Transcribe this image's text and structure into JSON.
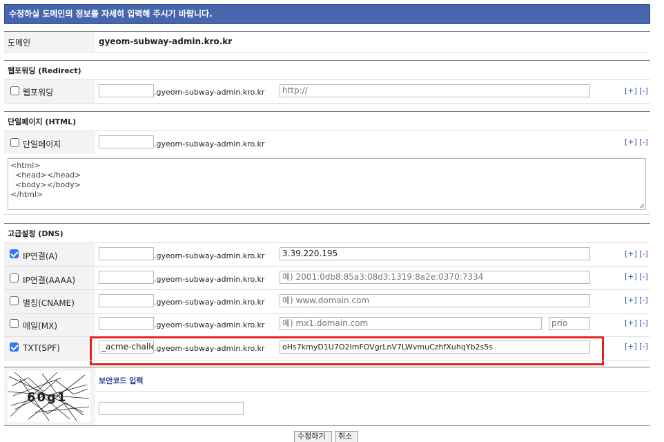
{
  "banner": "수정하실 도메인의 정보를 자세히 입력해 주시기 바랍니다.",
  "domain_row": {
    "label": "도메인",
    "value": "gyeom-subway-admin.kro.kr"
  },
  "suffix": ".gyeom-subway-admin.kro.kr",
  "plus_minus": "[+] [-]",
  "redirect": {
    "section": "웹포워딩 (Redirect)",
    "label": "웹포워딩",
    "checked": false,
    "host": "",
    "url_placeholder": "http://"
  },
  "html": {
    "section": "단일페이지 (HTML)",
    "label": "단일페이지",
    "checked": false,
    "host": "",
    "content": "<html>\n  <head></head>\n  <body></body>\n</html>"
  },
  "dns": {
    "section": "고급설정 (DNS)",
    "records": [
      {
        "label": "IP연결(A)",
        "checked": true,
        "host": "",
        "value": "3.39.220.195",
        "placeholder": false
      },
      {
        "label": "IP연결(AAAA)",
        "checked": false,
        "host": "",
        "value": "예) 2001:0db8:85a3:08d3:1319:8a2e:0370:7334",
        "placeholder": true
      },
      {
        "label": "별칭(CNAME)",
        "checked": false,
        "host": "",
        "value": "예) www.domain.com",
        "placeholder": true
      },
      {
        "label": "메일(MX)",
        "checked": false,
        "host": "",
        "value": "예) mx1.domain.com",
        "placeholder": true,
        "prio": "prio"
      },
      {
        "label": "TXT(SPF)",
        "checked": true,
        "host": "_acme-challer",
        "value": "oHs7kmyD1U7O2ImFOVgrLnV7LWvmuCzhfXuhqYb2s5s",
        "placeholder": false
      }
    ]
  },
  "security": {
    "label": "보안코드 입력",
    "captcha_text": "60g1",
    "input_value": ""
  },
  "buttons": {
    "submit": "수정하기",
    "cancel": "취소"
  },
  "colors": {
    "banner": "#4766ae",
    "highlight": "#e02222",
    "checkbox": "#3478f6"
  }
}
